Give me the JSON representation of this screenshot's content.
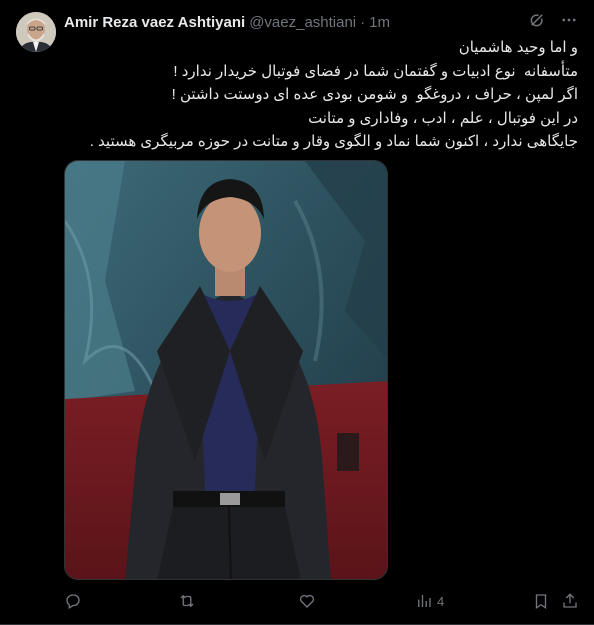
{
  "author": {
    "name": "Amir Reza vaez Ashtiyani",
    "handle": "@vaez_ashtiani",
    "separator": "·",
    "time": "1m"
  },
  "tweet": {
    "lines": [
      "و اما وحید هاشمیان",
      "متأسفانه  نوع ادبیات و گفتمان شما در فضای فوتبال خریدار ندارد !",
      "اگر لمپن ، حراف ، دروغگو  و شومن بودی عده ای دوستت داشتن !",
      "در این فوتبال ، علم ، ادب ، وفاداری و متانت",
      "جایگاهی ندارد ، اکنون شما نماد و الگوی وقار و متانت در حوزه مربیگری هستید ."
    ]
  },
  "actions": {
    "views_count": "4"
  },
  "colors": {
    "background": "#000000",
    "text": "#e7e9ea",
    "muted": "#71767b",
    "border": "#2f3336"
  },
  "icons": {
    "header": [
      "grok-icon",
      "more-icon"
    ],
    "actions": [
      "reply-icon",
      "retweet-icon",
      "like-icon",
      "views-icon",
      "bookmark-icon",
      "share-icon"
    ]
  }
}
